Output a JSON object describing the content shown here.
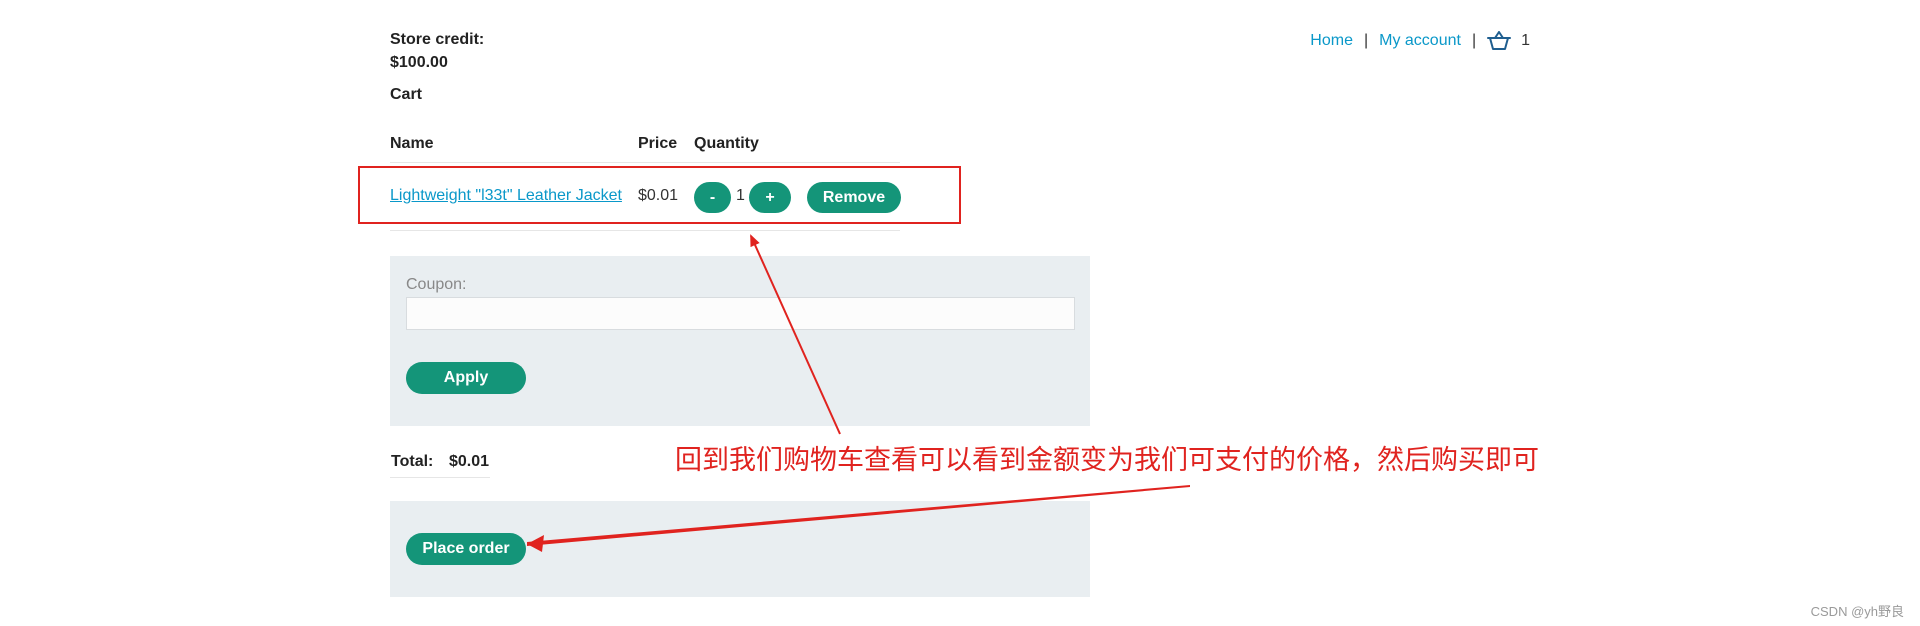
{
  "store_credit": {
    "label": "Store credit:",
    "value": "$100.00"
  },
  "cart": {
    "heading": "Cart"
  },
  "nav": {
    "home": "Home",
    "my_account": "My account",
    "separator": "|",
    "cart_count": "1",
    "cart_icon": "basket-icon"
  },
  "table": {
    "headers": [
      "Name",
      "Price",
      "Quantity"
    ],
    "rows": [
      {
        "name": "Lightweight \"l33t\" Leather Jacket",
        "price": "$0.01",
        "quantity": "1"
      }
    ],
    "minus_label": "-",
    "plus_label": "+",
    "remove_label": "Remove"
  },
  "coupon": {
    "label": "Coupon:",
    "value": "",
    "apply_label": "Apply"
  },
  "total": {
    "label": "Total:",
    "value": "$0.01"
  },
  "order": {
    "place_label": "Place order"
  },
  "annotation": {
    "text": "回到我们购物车查看可以看到金额变为我们可支付的价格，然后购买即可"
  },
  "watermark": "CSDN @yh野良",
  "colors": {
    "accent": "#149579",
    "link": "#0a98c9",
    "annotation": "#e0231f",
    "panel": "#e9eef1"
  }
}
